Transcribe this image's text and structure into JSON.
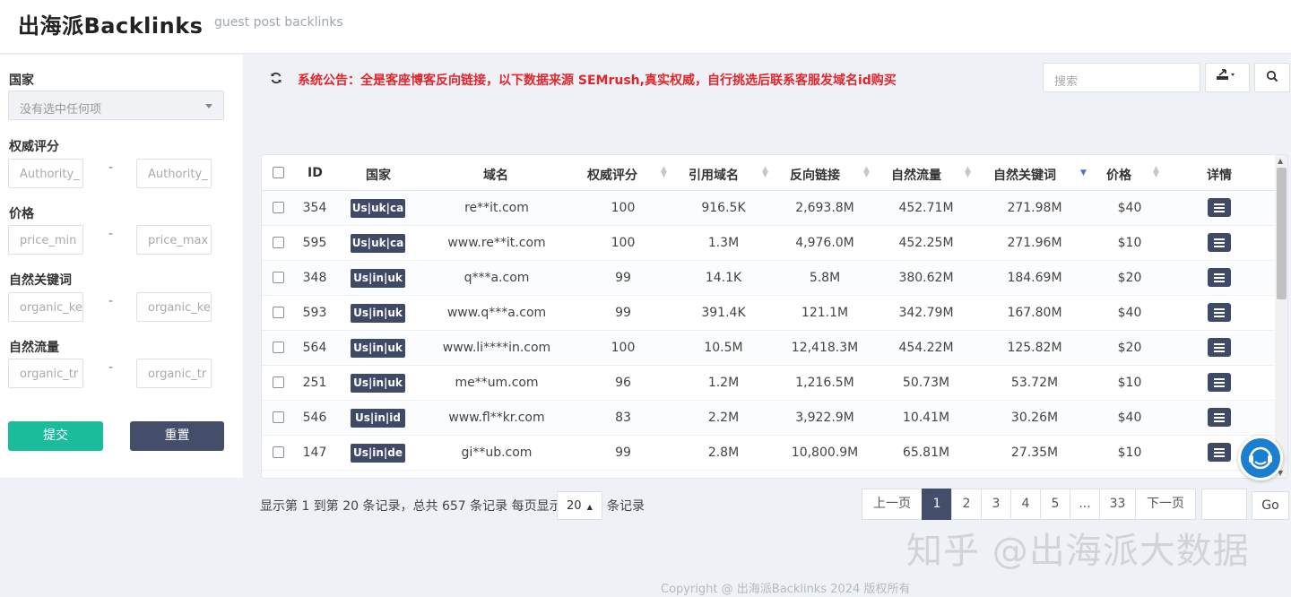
{
  "header": {
    "logo": "出海派Backlinks",
    "subtitle": "guest post backlinks"
  },
  "filters": {
    "country_label": "国家",
    "country_placeholder": "没有选中任何项",
    "authority_label": "权威评分",
    "authority_min": "Authority_",
    "authority_max": "Authority_",
    "price_label": "价格",
    "price_min": "price_min",
    "price_max": "price_max",
    "keywords_label": "自然关键词",
    "keywords_min": "organic_ke",
    "keywords_max": "organic_ke",
    "traffic_label": "自然流量",
    "traffic_min": "organic_tr",
    "traffic_max": "organic_tr",
    "dash": "-",
    "submit": "提交",
    "reset": "重置"
  },
  "toolbar": {
    "notice": "系统公告：全是客座博客反向链接，以下数据来源 SEMrush,真实权威，自行挑选后联系客服发域名id购买",
    "search_placeholder": "搜索"
  },
  "table": {
    "headers": {
      "id": "ID",
      "country": "国家",
      "domain": "域名",
      "authority": "权威评分",
      "ref_domains": "引用域名",
      "backlinks": "反向链接",
      "traffic": "自然流量",
      "keywords": "自然关键词",
      "price": "价格",
      "detail": "详情"
    },
    "rows": [
      {
        "id": "354",
        "country": "Us|uk|ca",
        "domain": "re**it.com",
        "authority": "100",
        "ref_domains": "916.5K",
        "backlinks": "2,693.8M",
        "traffic": "452.71M",
        "keywords": "271.98M",
        "price": "$40"
      },
      {
        "id": "595",
        "country": "Us|uk|ca",
        "domain": "www.re**it.com",
        "authority": "100",
        "ref_domains": "1.3M",
        "backlinks": "4,976.0M",
        "traffic": "452.25M",
        "keywords": "271.96M",
        "price": "$10"
      },
      {
        "id": "348",
        "country": "Us|in|uk",
        "domain": "q***a.com",
        "authority": "99",
        "ref_domains": "14.1K",
        "backlinks": "5.8M",
        "traffic": "380.62M",
        "keywords": "184.69M",
        "price": "$20"
      },
      {
        "id": "593",
        "country": "Us|in|uk",
        "domain": "www.q***a.com",
        "authority": "99",
        "ref_domains": "391.4K",
        "backlinks": "121.1M",
        "traffic": "342.79M",
        "keywords": "167.80M",
        "price": "$40"
      },
      {
        "id": "564",
        "country": "Us|in|uk",
        "domain": "www.li****in.com",
        "authority": "100",
        "ref_domains": "10.5M",
        "backlinks": "12,418.3M",
        "traffic": "454.22M",
        "keywords": "125.82M",
        "price": "$20"
      },
      {
        "id": "251",
        "country": "Us|in|uk",
        "domain": "me**um.com",
        "authority": "96",
        "ref_domains": "1.2M",
        "backlinks": "1,216.5M",
        "traffic": "50.73M",
        "keywords": "53.72M",
        "price": "$10"
      },
      {
        "id": "546",
        "country": "Us|in|id",
        "domain": "www.fl**kr.com",
        "authority": "83",
        "ref_domains": "2.2M",
        "backlinks": "3,922.9M",
        "traffic": "10.41M",
        "keywords": "30.26M",
        "price": "$40"
      },
      {
        "id": "147",
        "country": "Us|in|de",
        "domain": "gi**ub.com",
        "authority": "99",
        "ref_domains": "2.8M",
        "backlinks": "10,800.9M",
        "traffic": "65.81M",
        "keywords": "27.35M",
        "price": "$10"
      }
    ]
  },
  "pagination": {
    "info": "显示第 1 到第 20 条记录，总共 657 条记录 每页显示",
    "page_size": "20",
    "suffix": "条记录",
    "prev": "上一页",
    "pages": [
      "1",
      "2",
      "3",
      "4",
      "5",
      "...",
      "33"
    ],
    "next": "下一页",
    "go": "Go"
  },
  "watermark": "知乎 @出海派大数据",
  "copyright": "Copyright @ 出海派Backlinks 2024 版权所有",
  "icons": {
    "refresh": "refresh-icon",
    "export": "export-icon",
    "search": "search-icon",
    "detail": "list-icon",
    "chat": "customer-service-icon"
  },
  "colors": {
    "accent": "#1abc9c",
    "dark": "#444d6a",
    "notice": "#e0262b"
  }
}
